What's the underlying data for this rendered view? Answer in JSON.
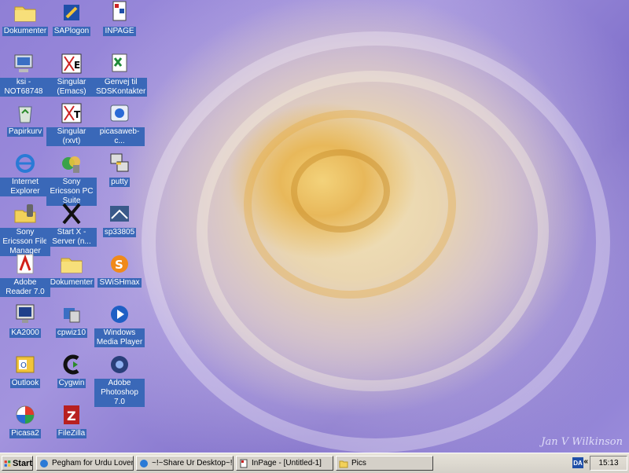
{
  "desktop": {
    "icons": [
      {
        "label": "Dokumenter",
        "icon": "folder-icon"
      },
      {
        "label": "SAPlogon",
        "icon": "sap-icon"
      },
      {
        "label": "INPAGE",
        "icon": "inpage-icon"
      },
      {
        "label": "ksi - NOT68748",
        "icon": "computer-icon"
      },
      {
        "label": "Singular (Emacs)",
        "icon": "singular-emacs-icon"
      },
      {
        "label": "Genvej til SDSKontakter",
        "icon": "excel-shortcut-icon"
      },
      {
        "label": "Papirkurv",
        "icon": "recycle-bin-icon"
      },
      {
        "label": "Singular (rxvt)",
        "icon": "singular-rxvt-icon"
      },
      {
        "label": "picasaweb-c...",
        "icon": "picasaweb-icon"
      },
      {
        "label": "Internet Explorer",
        "icon": "ie-icon"
      },
      {
        "label": "Sony Ericsson PC Suite",
        "icon": "pc-suite-icon"
      },
      {
        "label": "putty",
        "icon": "putty-icon"
      },
      {
        "label": "Sony Ericsson File Manager",
        "icon": "file-manager-icon"
      },
      {
        "label": "Start X - Server (n...",
        "icon": "x-server-icon"
      },
      {
        "label": "sp33805",
        "icon": "installer-icon"
      },
      {
        "label": "Adobe Reader 7.0",
        "icon": "adobe-reader-icon"
      },
      {
        "label": "Dokumenter",
        "icon": "folder-icon"
      },
      {
        "label": "SWiSHmax",
        "icon": "swishmax-icon"
      },
      {
        "label": "KA2000",
        "icon": "monitor-icon"
      },
      {
        "label": "cpwiz10",
        "icon": "wizard-icon"
      },
      {
        "label": "Windows Media Player",
        "icon": "media-player-icon"
      },
      {
        "label": "Outlook",
        "icon": "outlook-icon"
      },
      {
        "label": "Cygwin",
        "icon": "cygwin-icon"
      },
      {
        "label": "Adobe Photoshop 7.0",
        "icon": "photoshop-icon"
      },
      {
        "label": "Picasa2",
        "icon": "picasa-icon"
      },
      {
        "label": "FileZilla",
        "icon": "filezilla-icon"
      }
    ],
    "signature": "Jan V Wilkinson"
  },
  "taskbar": {
    "start_label": "Start",
    "tasks": [
      {
        "label": "Pegham for Urdu Lovers ...",
        "icon": "browser-window-icon"
      },
      {
        "label": "~!~Share Ur Desktop~!...",
        "icon": "browser-window-icon"
      },
      {
        "label": "InPage - [Untitled-1]",
        "icon": "inpage-window-icon"
      },
      {
        "label": "Pics",
        "icon": "folder-icon"
      }
    ],
    "language": "DA",
    "chevron": "«",
    "clock": "15:13"
  },
  "colors": {
    "label_bg": "#3a68b8",
    "taskbar_bg": "#d4d0c8",
    "accent": "#1f4fa8"
  }
}
